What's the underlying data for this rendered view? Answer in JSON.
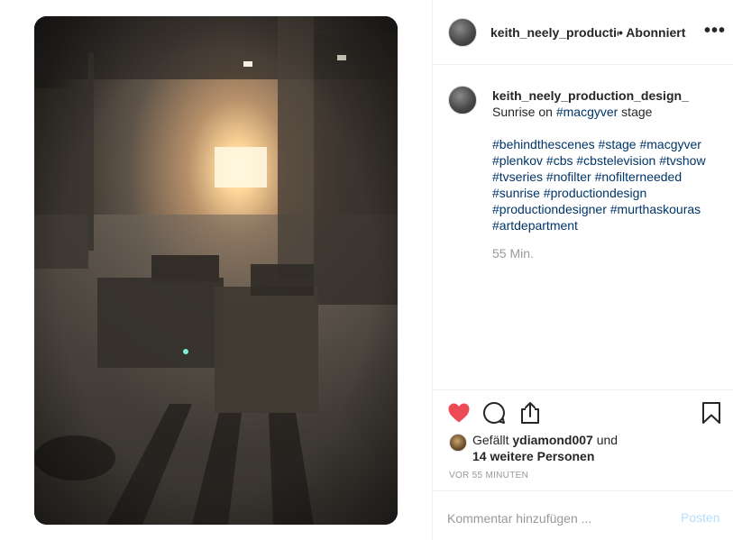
{
  "header": {
    "username": "keith_neely_production_design_",
    "separator": "•",
    "follow_label": "Abonniert",
    "more_icon": "more-options-icon"
  },
  "caption": {
    "username": "keith_neely_production_design_",
    "text_before": "Sunrise on ",
    "text_tag": "#macgyver",
    "text_after": " stage",
    "hashtag_lines": [
      "#behindthescenes #stage #macgyver",
      "#plenkov #cbs #cbstelevision #tvshow",
      "#tvseries #nofilter #nofilterneeded",
      "#sunrise #productiondesign",
      "#productiondesigner #murthaskouras",
      "#artdepartment"
    ],
    "time": "55 Min."
  },
  "actions": {
    "like_icon": "heart-filled-icon",
    "comment_icon": "comment-bubble-icon",
    "share_icon": "share-icon",
    "save_icon": "bookmark-icon",
    "like_color": "#ed4956"
  },
  "likes": {
    "prefix": "Gefällt ",
    "user": "ydiamond007",
    "suffix": " und",
    "others": "14 weitere Personen"
  },
  "timestamp": "VOR 55 MINUTEN",
  "add_comment": {
    "placeholder": "Kommentar hinzufügen ...",
    "post_label": "Posten"
  },
  "colors": {
    "hashtag": "#003569",
    "muted": "#999999",
    "post_disabled": "#b2dffc"
  }
}
